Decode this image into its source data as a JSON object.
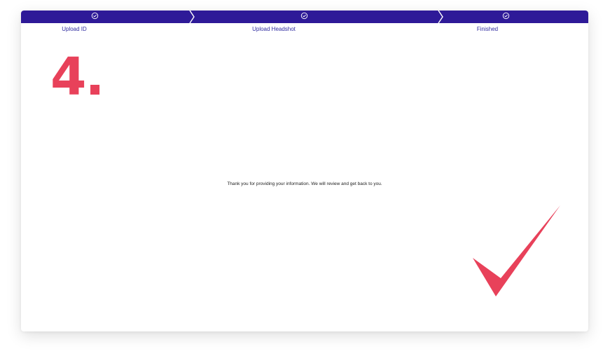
{
  "colors": {
    "stepbar": "#2e1a98",
    "accent": "#e8415a",
    "label": "#2e2aa0"
  },
  "steps": [
    {
      "label": "Upload ID",
      "icon": "check-circle-icon",
      "completed": true
    },
    {
      "label": "Upload Headshot",
      "icon": "check-circle-icon",
      "completed": true
    },
    {
      "label": "Finished",
      "icon": "check-circle-icon",
      "completed": true
    }
  ],
  "step_number": "4.",
  "message": "Thank you for providing your information. We will review and get back to you.",
  "completion_icon": "large-checkmark-icon"
}
